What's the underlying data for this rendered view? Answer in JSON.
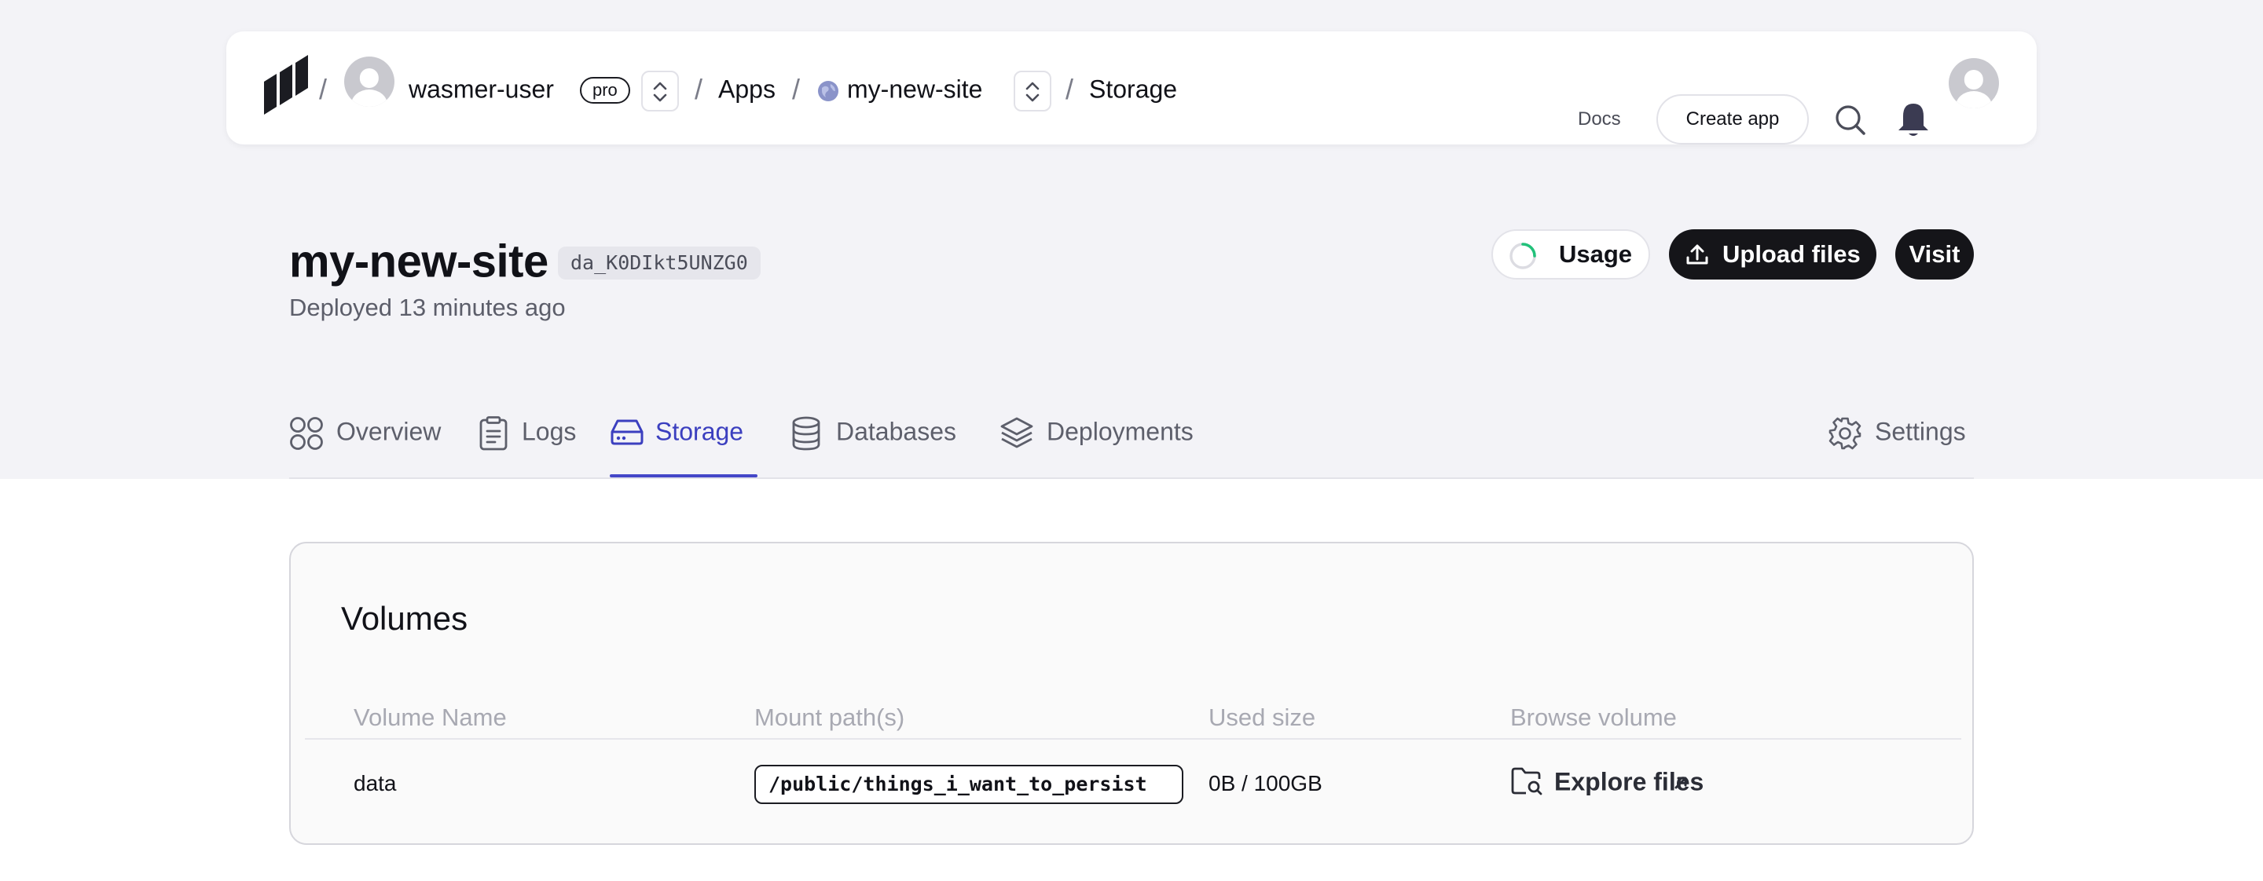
{
  "nav": {
    "user": "wasmer-user",
    "plan_badge": "pro",
    "apps": "Apps",
    "app": "my-new-site",
    "page": "Storage",
    "docs": "Docs",
    "create_app": "Create app"
  },
  "header": {
    "title": "my-new-site",
    "app_id": "da_K0DIkt5UNZG0",
    "deployed": "Deployed 13 minutes ago",
    "usage": "Usage",
    "upload": "Upload files",
    "visit": "Visit"
  },
  "tabs": [
    {
      "label": "Overview",
      "icon": "grid-icon"
    },
    {
      "label": "Logs",
      "icon": "clipboard-icon"
    },
    {
      "label": "Storage",
      "icon": "hard-drive-icon",
      "active": true
    },
    {
      "label": "Databases",
      "icon": "database-icon"
    },
    {
      "label": "Deployments",
      "icon": "layers-icon"
    },
    {
      "label": "Settings",
      "icon": "gear-icon"
    }
  ],
  "volumes": {
    "title": "Volumes",
    "columns": [
      "Volume Name",
      "Mount path(s)",
      "Used size",
      "Browse volume"
    ],
    "rows": [
      {
        "name": "data",
        "mount": "/public/things_i_want_to_persist",
        "used": "0B / 100GB",
        "browse": "Explore files"
      }
    ]
  },
  "colors": {
    "accent": "#4447c8",
    "usage_ring": "#22c17a",
    "dark_button": "#151519"
  }
}
